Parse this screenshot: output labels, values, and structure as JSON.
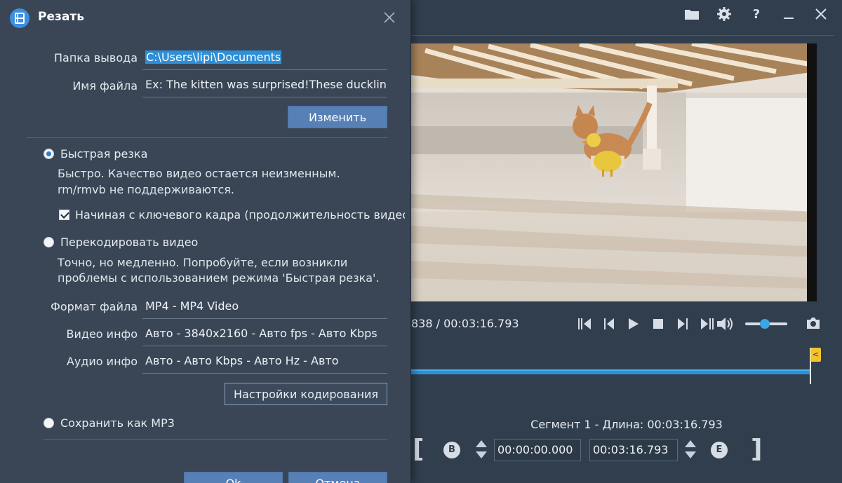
{
  "main": {
    "time_readout": "838 / 00:03:16.793",
    "segment_label": "Сегмент 1 - Длина: 00:03:16.793",
    "segment_start": "00:00:00.000",
    "segment_end": "00:03:16.793",
    "begin_marker": "B",
    "end_marker": "E",
    "timeline_flag": "<",
    "volume_level": 0.45
  },
  "dialog": {
    "title": "Резать",
    "output_folder_label": "Папка вывода",
    "output_folder_value": "C:\\Users\\lipi\\Documents",
    "file_name_label": "Имя файла",
    "file_name_value": "Ex: The kitten was surprised!These duckling",
    "change_button": "Изменить",
    "fast_cut_label": "Быстрая резка",
    "fast_cut_desc_line1": "Быстро. Качество видео остается неизменным.",
    "fast_cut_desc_line2": "rm/rmvb не поддерживаются.",
    "keyframe_label": "Начиная с ключевого кадра (продолжительность видео",
    "reencode_label": "Перекодировать видео",
    "reencode_desc_line1": "Точно, но медленно. Попробуйте, если возникли",
    "reencode_desc_line2": "проблемы с использованием режима 'Быстрая резка'.",
    "file_format_label": "Формат файла",
    "file_format_value": "MP4 - MP4 Video",
    "video_info_label": "Видео инфо",
    "video_info_value": "Авто - 3840x2160 - Авто fps - Авто Kbps",
    "audio_info_label": "Аудио инфо",
    "audio_info_value": "Авто - Авто Kbps - Авто Hz - Авто",
    "encoding_settings_button": "Настройки кодирования",
    "save_mp3_label": "Сохранить как MP3",
    "ok_button": "Ok",
    "cancel_button": "Отмена"
  },
  "colors": {
    "accent": "#2f8fd6",
    "button": "#5680b6",
    "dialog_bg": "#3a4656",
    "window_bg": "#313e4e"
  },
  "icons": [
    "folder-icon",
    "gear-icon",
    "help-icon",
    "minimize-icon",
    "close-icon",
    "app-icon",
    "volume-icon",
    "camera-icon"
  ]
}
